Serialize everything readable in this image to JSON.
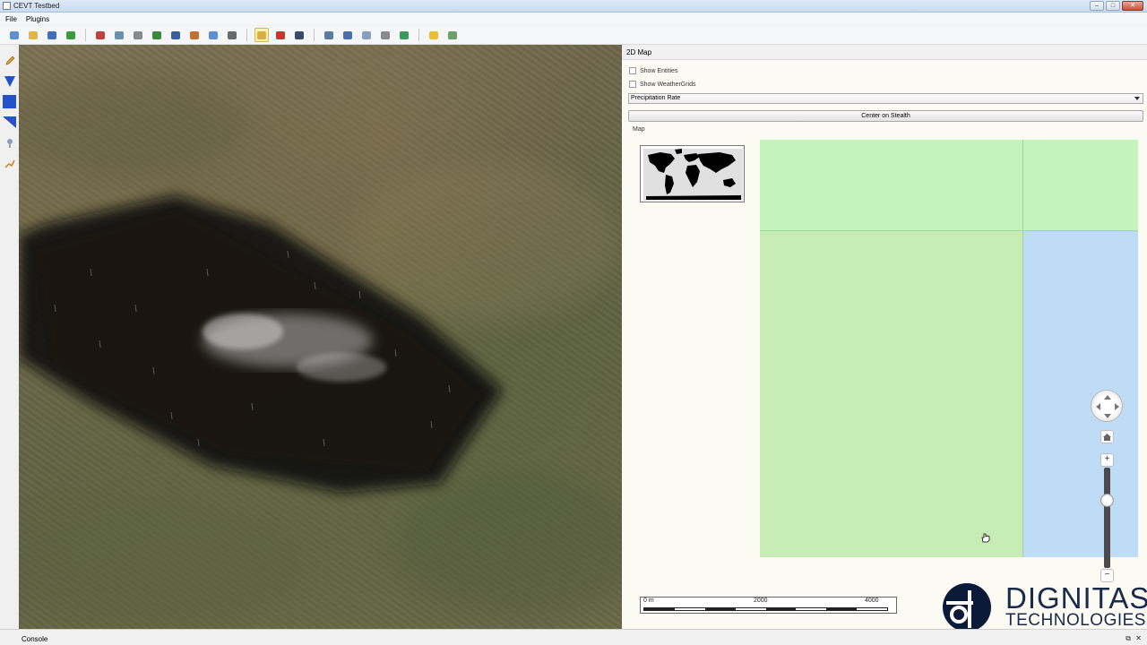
{
  "window": {
    "title": "CEVT Testbed",
    "controls": [
      "–",
      "□",
      "✕"
    ]
  },
  "menu": {
    "items": [
      "File",
      "Plugins"
    ]
  },
  "toolbar": {
    "icons": [
      {
        "name": "new-file-icon",
        "color": "#5b8fd8"
      },
      {
        "name": "open-folder-icon",
        "color": "#e0b64a"
      },
      {
        "name": "save-icon",
        "color": "#3f6fb8"
      },
      {
        "name": "refresh-icon",
        "color": "#3d9b3d"
      },
      {
        "name": "graph-icon",
        "color": "#c04040"
      },
      {
        "name": "flag-icon",
        "color": "#6a8fb0"
      },
      {
        "name": "person-icon",
        "color": "#8a8a8a"
      },
      {
        "name": "tank-icon",
        "color": "#3a8a3a"
      },
      {
        "name": "vehicle-icon",
        "color": "#3a5fa0"
      },
      {
        "name": "bomb-icon",
        "color": "#c07030"
      },
      {
        "name": "document-icon",
        "color": "#5b8fd8"
      },
      {
        "name": "truck-icon",
        "color": "#6a6a6a"
      },
      {
        "name": "map-toggle-icon",
        "color": "#d8b040",
        "active": true
      },
      {
        "name": "route-icon",
        "color": "#d03030"
      },
      {
        "name": "camera-icon",
        "color": "#3a4a6a"
      },
      {
        "name": "chart-icon",
        "color": "#5a7aa0"
      },
      {
        "name": "wrench-icon",
        "color": "#4a6fb0"
      },
      {
        "name": "cloud-icon",
        "color": "#8aa0c0"
      },
      {
        "name": "gear-icon",
        "color": "#8a8a8a"
      },
      {
        "name": "globe-icon",
        "color": "#3a9a5a"
      },
      {
        "name": "lightbulb-icon",
        "color": "#e8c030"
      },
      {
        "name": "settings-icon",
        "color": "#6aa06a"
      }
    ]
  },
  "palette": {
    "icons": [
      "pencil-icon",
      "triangle-down-icon",
      "square-icon",
      "wedge-icon",
      "pin-icon",
      "path-icon"
    ]
  },
  "panel": {
    "title": "2D Map",
    "show_entities_label": "Show Entities",
    "show_entities_checked": false,
    "show_weathergrids_label": "Show WeatherGrids",
    "show_weathergrids_checked": false,
    "layer_select_value": "Precipitation Rate",
    "center_button_label": "Center on Stealth",
    "map_tab_label": "Map",
    "tile_colors": {
      "top_left": "#c4f4bc",
      "top_right": "#c4f4bc",
      "bottom_left": "#c8ecb6",
      "bottom_right": "#bfdcf6",
      "border": "#9ad894"
    },
    "nav": {
      "home_icon": "home-icon",
      "zoom_in_label": "+",
      "zoom_out_label": "−",
      "zoom_level_fraction": 0.3
    },
    "scalebar": {
      "labels": [
        "0 m",
        "2000",
        "4000"
      ]
    }
  },
  "logo": {
    "line1": "DIGNITAS",
    "line2": "TECHNOLOGIES",
    "color": "#1a2a4a"
  },
  "console": {
    "label": "Console"
  }
}
